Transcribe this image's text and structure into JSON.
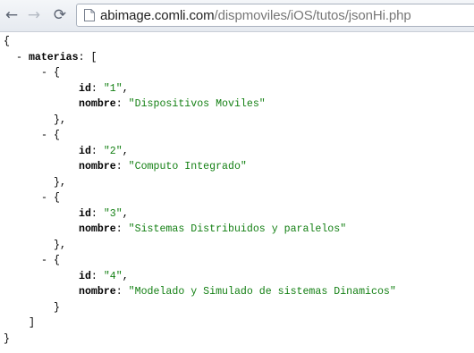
{
  "browser": {
    "back_glyph": "←",
    "forward_glyph": "→",
    "reload_glyph": "⟳",
    "url_host": "abimage.comli.com",
    "url_path": "/dispmoviles/iOS/tutos/jsonHi.php"
  },
  "json_view": {
    "open_brace": "{",
    "close_brace": "}",
    "collapse_glyph": "-",
    "root_key": "materias",
    "open_bracket": "[",
    "close_bracket": "]",
    "item_open": "{",
    "item_close": "}",
    "item_close_comma": "},",
    "id_key": "id",
    "nombre_key": "nombre",
    "items": [
      {
        "id": "\"1\"",
        "nombre": "\"Dispositivos Moviles\""
      },
      {
        "id": "\"2\"",
        "nombre": "\"Computo Integrado\""
      },
      {
        "id": "\"3\"",
        "nombre": "\"Sistemas Distribuidos y paralelos\""
      },
      {
        "id": "\"4\"",
        "nombre": "\"Modelado y Simulado de sistemas Dinamicos\""
      }
    ]
  },
  "colors": {
    "string_value": "#148014",
    "key": "#000000"
  }
}
